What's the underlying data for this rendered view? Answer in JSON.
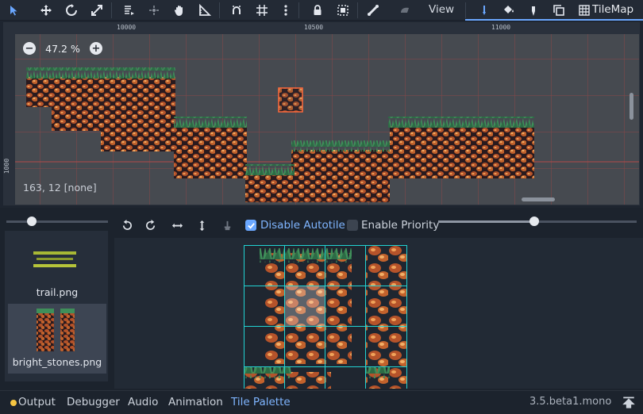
{
  "toolbar": {
    "icons": [
      "select-arrow-icon",
      "move-icon",
      "rotate-icon",
      "scale-icon",
      "list-icon",
      "pivot-icon",
      "pan-hand-icon",
      "ruler-icon",
      "smart-snap-icon",
      "grid-snap-icon",
      "more-vertical-icon",
      "lock-icon",
      "group-icon",
      "bone-icon",
      "skeleton-icon"
    ],
    "view_label": "View",
    "tilemap_label": "TileMap"
  },
  "viewport": {
    "ruler_top": [
      "10000",
      "10500",
      "11000"
    ],
    "ruler_left": [
      "1000"
    ],
    "zoom": "47.2 %",
    "coords": "163, 12 [none]"
  },
  "palette": {
    "disable_autotile": "Disable Autotile",
    "enable_priority": "Enable Priority",
    "textures": [
      {
        "name": "trail.png"
      },
      {
        "name": "bright_stones.png"
      }
    ]
  },
  "bottom": {
    "tabs": [
      "Output",
      "Debugger",
      "Audio",
      "Animation",
      "Tile Palette"
    ],
    "version": "3.5.beta1.mono"
  },
  "colors": {
    "accent": "#6aa7ff",
    "stone": "#b5532a",
    "grass": "#3f8f5a",
    "grid": "#22d3d3"
  }
}
